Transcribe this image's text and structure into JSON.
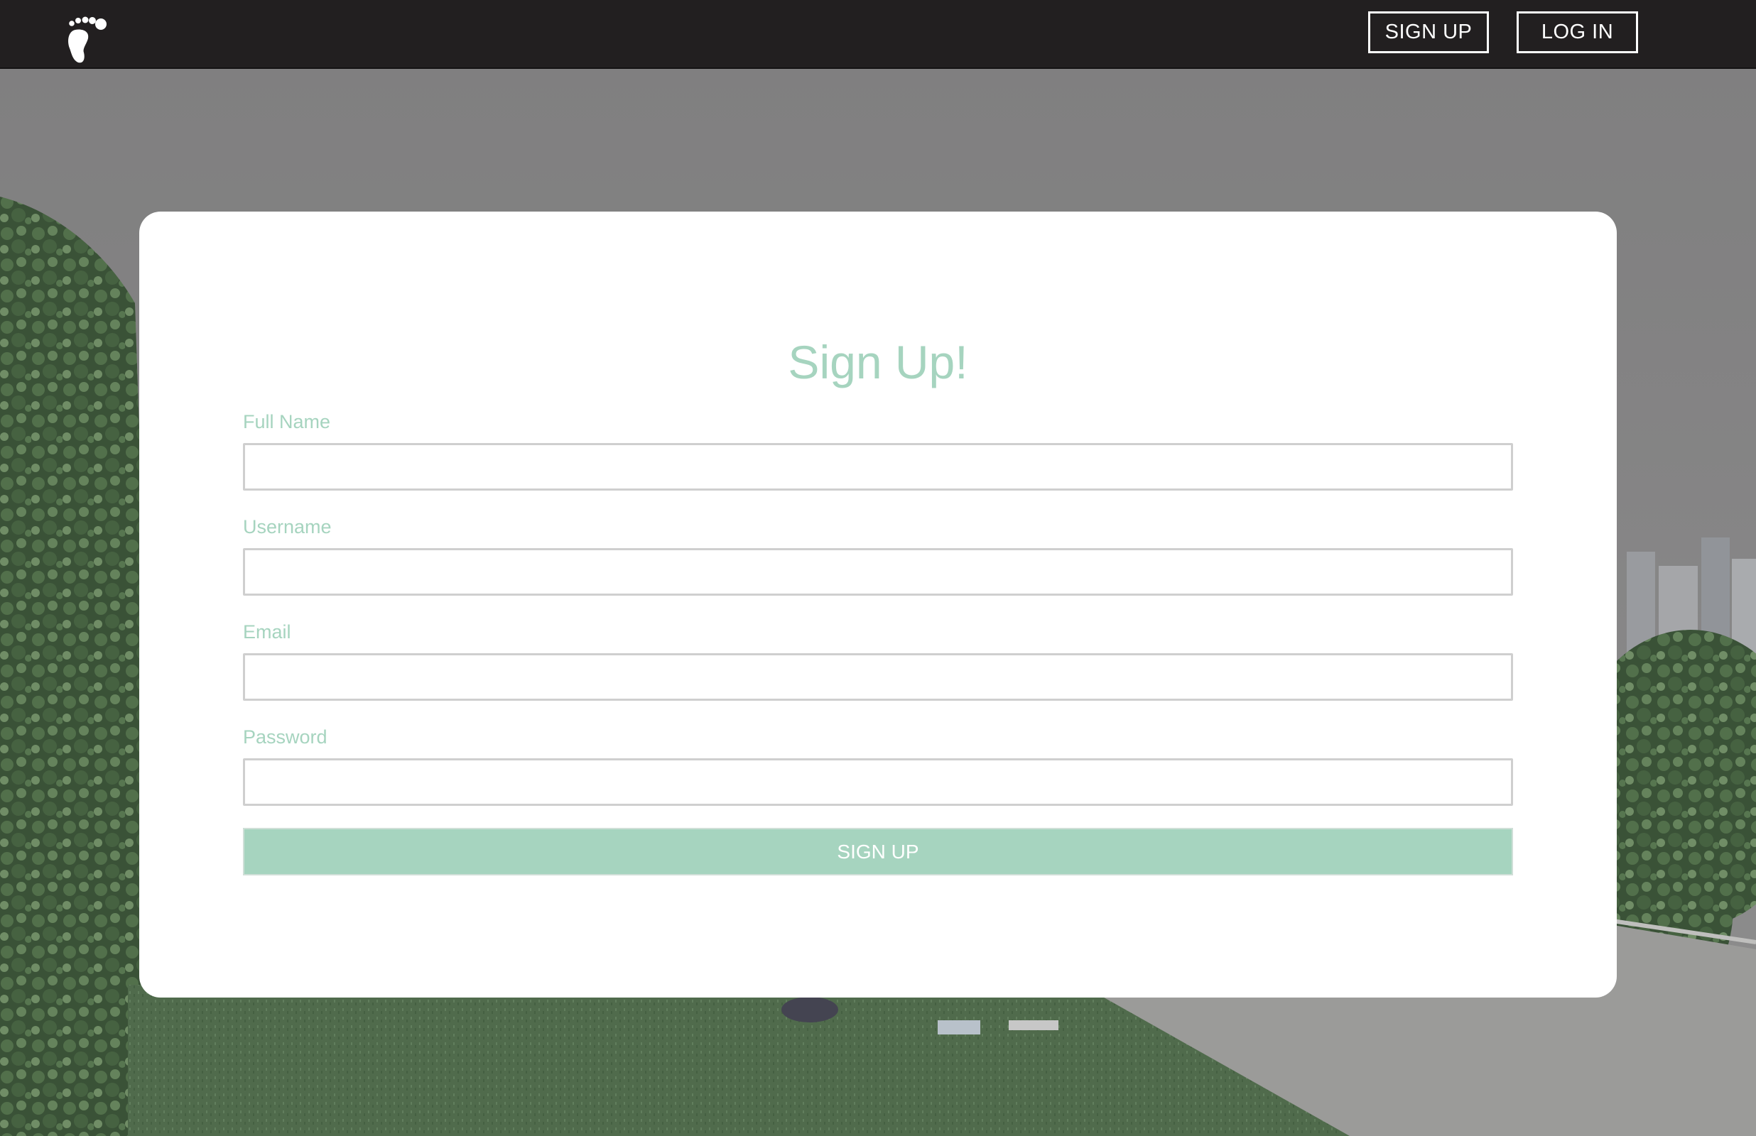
{
  "nav": {
    "logo_icon": "footprint-icon",
    "signup_label": "SIGN UP",
    "login_label": "LOG IN"
  },
  "form": {
    "title": "Sign Up!",
    "fields": [
      {
        "label": "Full Name",
        "value": "",
        "placeholder": ""
      },
      {
        "label": "Username",
        "value": "",
        "placeholder": ""
      },
      {
        "label": "Email",
        "value": "",
        "placeholder": ""
      },
      {
        "label": "Password",
        "value": "",
        "placeholder": ""
      }
    ],
    "submit_label": "SIGN UP"
  },
  "colors": {
    "nav_background": "#221f20",
    "accent": "#a6d4bf",
    "card_background": "#ffffff",
    "input_border": "#cfcfcf"
  }
}
